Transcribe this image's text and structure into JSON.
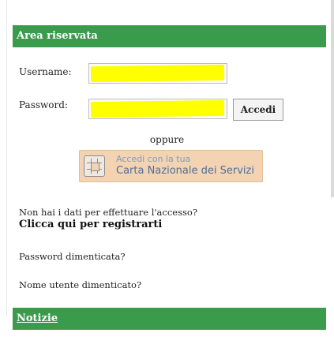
{
  "area_header": "Area riservata",
  "username": {
    "label": "Username:",
    "value": ""
  },
  "password": {
    "label": "Password:",
    "value": ""
  },
  "login_button": "Accedi",
  "oppure": "oppure",
  "cns_button": {
    "line1": "Accedi con la tua",
    "line2": "Carta Nazionale dei Servizi",
    "icon": "smartcard-chip-icon"
  },
  "no_credentials_text": "Non hai i dati per effettuare l'accesso?",
  "register_link": "Clicca qui per registrarti",
  "forgot_password": "Password dimenticata?",
  "forgot_username": "Nome utente dimenticato?",
  "news_header": "Notizie",
  "colors": {
    "header_green": "#3a9b4d",
    "highlight_yellow": "#ffff00",
    "cns_button_bg": "#f3d3b2"
  }
}
